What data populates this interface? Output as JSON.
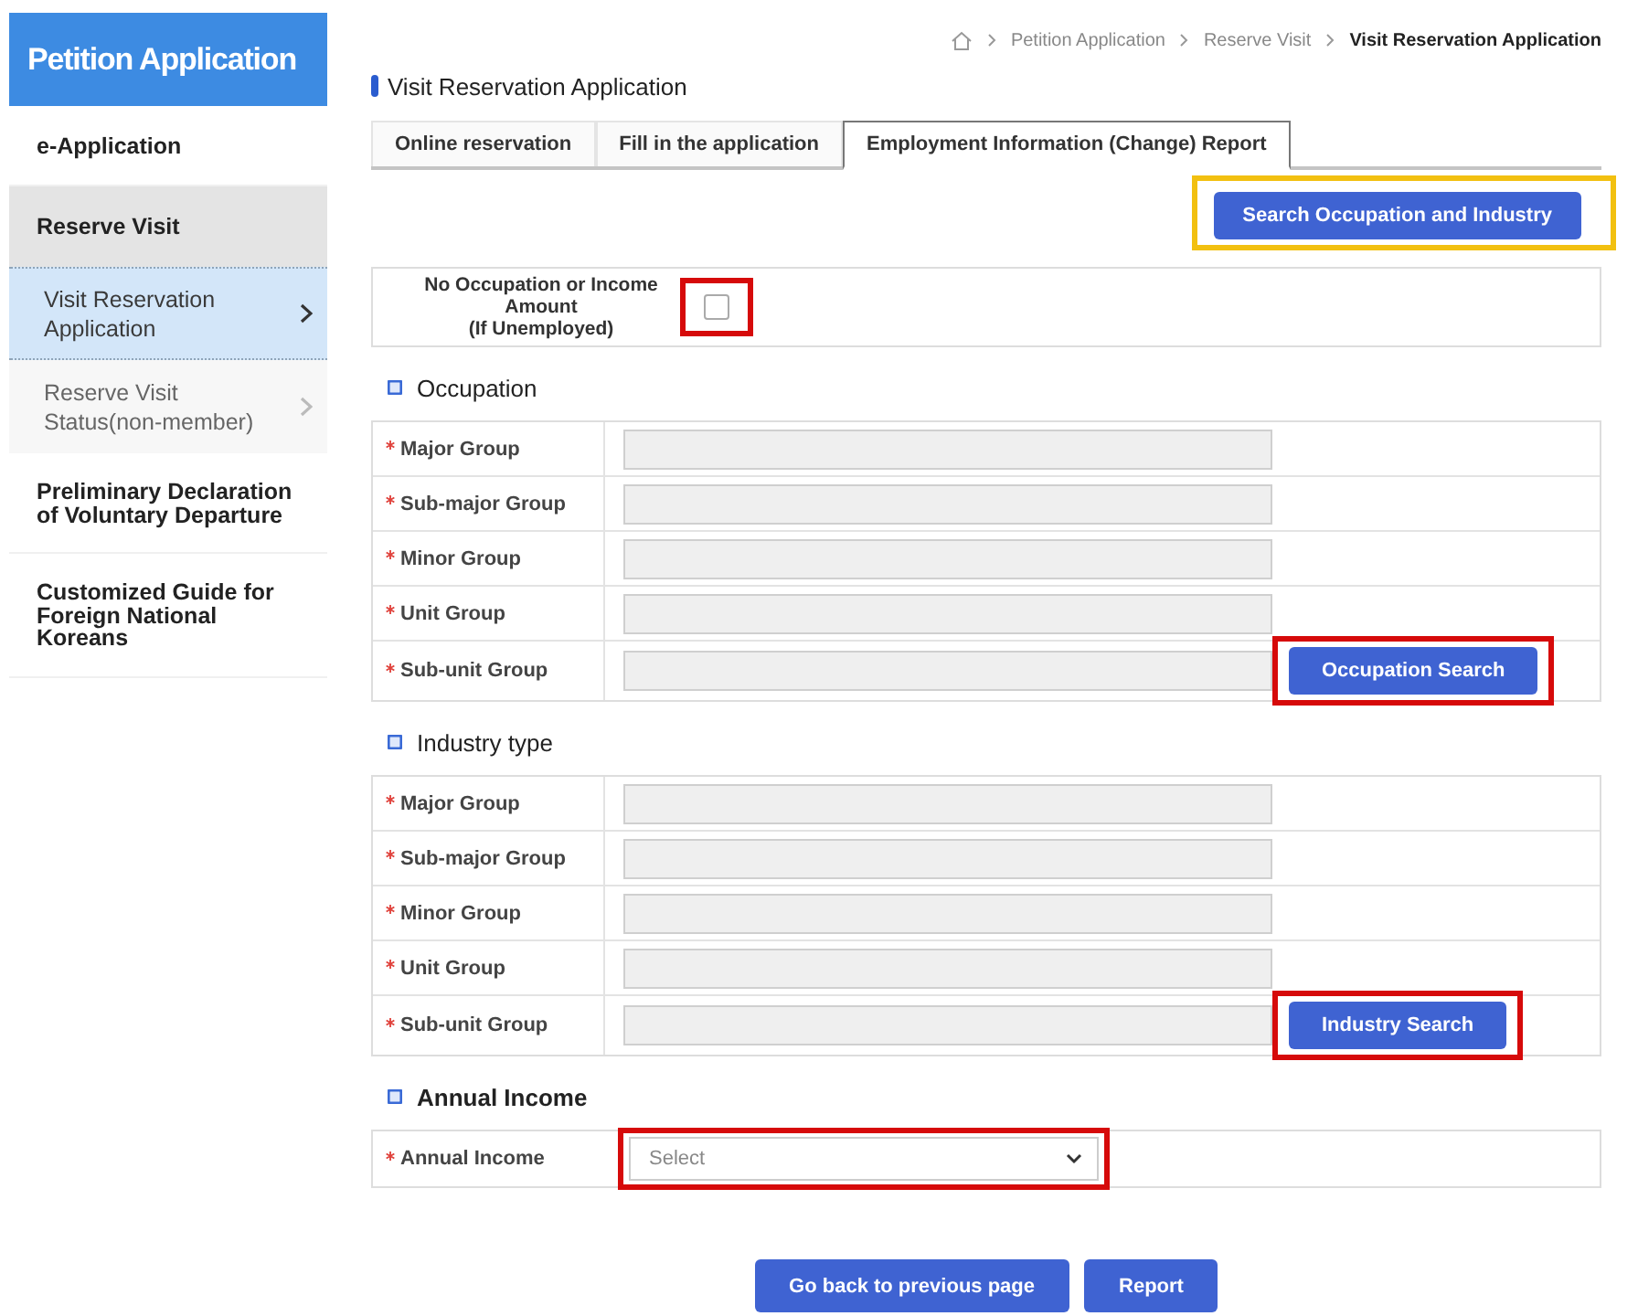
{
  "sidebar": {
    "title": "Petition Application",
    "items": [
      {
        "label": "e-Application",
        "selected": false
      },
      {
        "label": "Reserve Visit",
        "selected": true,
        "children": [
          {
            "label": "Visit Reservation Application",
            "selected": true
          },
          {
            "label": "Reserve Visit Status(non-member)",
            "selected": false
          }
        ]
      },
      {
        "label": "Preliminary Declaration of Voluntary Departure",
        "selected": false
      },
      {
        "label": "Customized Guide for Foreign National Koreans",
        "selected": false
      }
    ]
  },
  "breadcrumb": [
    "Petition Application",
    "Reserve Visit",
    "Visit Reservation Application"
  ],
  "page_title": "Visit Reservation Application",
  "tabs": [
    {
      "label": "Online reservation",
      "selected": false
    },
    {
      "label": "Fill in the application",
      "selected": false
    },
    {
      "label": "Employment Information (Change) Report",
      "selected": true
    }
  ],
  "search_button": {
    "label": "Search Occupation and Industry",
    "highlight": {
      "color": "#f2c010"
    }
  },
  "unemployed": {
    "label": "No Occupation or Income Amount",
    "note": "(If Unemployed)",
    "checked": false,
    "highlight": {
      "color": "#d60a0a"
    }
  },
  "sections": [
    {
      "title": "Occupation",
      "rows": [
        {
          "label": "Major Group",
          "required": true,
          "kind": "text",
          "disabled": true
        },
        {
          "label": "Sub-major Group",
          "required": true,
          "kind": "text",
          "disabled": true
        },
        {
          "label": "Minor Group",
          "required": true,
          "kind": "text",
          "disabled": true
        },
        {
          "label": "Unit Group",
          "required": true,
          "kind": "text",
          "disabled": true
        },
        {
          "label": "Sub-unit Group",
          "required": true,
          "kind": "text",
          "disabled": true,
          "button": {
            "label": "Occupation Search",
            "highlight": {
              "color": "#d60a0a"
            }
          }
        }
      ]
    },
    {
      "title": "Industry type",
      "rows": [
        {
          "label": "Major Group",
          "required": true,
          "kind": "text",
          "disabled": true
        },
        {
          "label": "Sub-major Group",
          "required": true,
          "kind": "text",
          "disabled": true
        },
        {
          "label": "Minor Group",
          "required": true,
          "kind": "text",
          "disabled": true
        },
        {
          "label": "Unit Group",
          "required": true,
          "kind": "text",
          "disabled": true
        },
        {
          "label": "Sub-unit Group",
          "required": true,
          "kind": "text",
          "disabled": true,
          "button": {
            "label": "Industry Search",
            "highlight": {
              "color": "#d60a0a"
            }
          }
        }
      ]
    },
    {
      "title": "Annual Income",
      "rows": [
        {
          "label": "Annual Income",
          "required": true,
          "kind": "select",
          "placeholder": "Select",
          "highlight": {
            "color": "#d60a0a"
          }
        }
      ]
    }
  ],
  "footer_buttons": [
    {
      "label": "Go back to previous page"
    },
    {
      "label": "Report"
    }
  ]
}
